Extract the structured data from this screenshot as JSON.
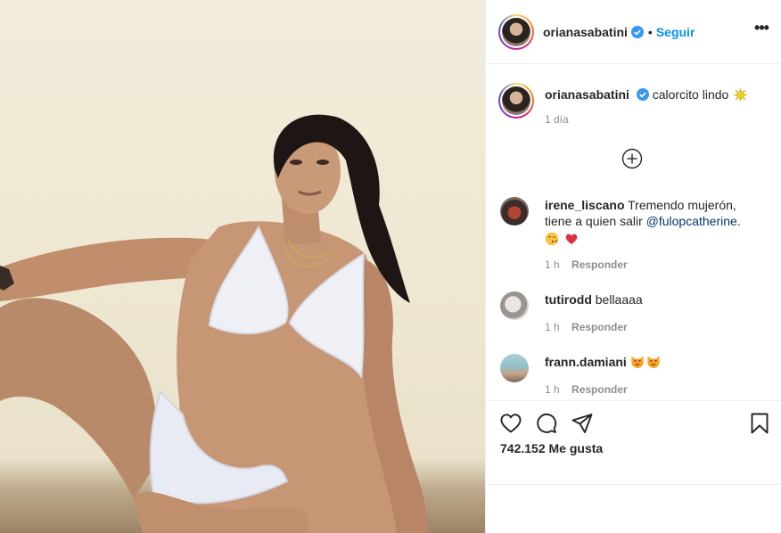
{
  "post": {
    "username": "orianasabatini",
    "follow_label": "Seguir",
    "separator": "•",
    "more_label": "•••"
  },
  "caption": {
    "username": "orianasabatini",
    "text": "calorcito lindo",
    "emoji": "sun-emoji",
    "time": "1 día"
  },
  "comments": [
    {
      "username": "irene_liscano",
      "text": "Tremendo mujerón, tiene a quien salir ",
      "mention": "@fulopcatherine",
      "after": ".",
      "emojis": [
        "blowing-kiss-emoji",
        "red-heart-emoji"
      ],
      "time": "1 h",
      "reply_label": "Responder"
    },
    {
      "username": "tutirodd",
      "text": "bellaaaa",
      "time": "1 h",
      "reply_label": "Responder"
    },
    {
      "username": "frann.damiani",
      "text": "",
      "emojis": [
        "heart-eyes-cat-emoji",
        "heart-eyes-cat-emoji"
      ],
      "time": "1 h",
      "reply_label": "Responder"
    }
  ],
  "likes": {
    "count": "742.152",
    "label": "Me gusta"
  },
  "colors": {
    "accent": "#0095f6",
    "verified": "#3897f0",
    "mention": "#00376b",
    "muted": "#8e8e8e",
    "heart": "#ed4956"
  },
  "icons": [
    "heart-icon",
    "comment-icon",
    "share-icon",
    "bookmark-icon",
    "add-circle-icon",
    "verified-badge-icon",
    "more-options-icon"
  ]
}
